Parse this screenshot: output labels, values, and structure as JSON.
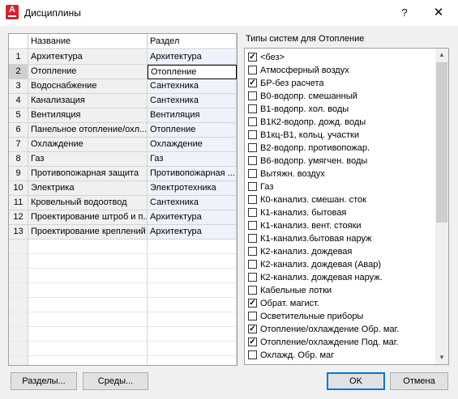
{
  "window": {
    "title": "Дисциплины",
    "help": "?",
    "close": "✕"
  },
  "grid": {
    "columns": [
      "",
      "Название",
      "Раздел"
    ],
    "rows": [
      [
        "1",
        "Архитектура",
        "Архитектура"
      ],
      [
        "2",
        "Отопление",
        "Отопление"
      ],
      [
        "3",
        "Водоснабжение",
        "Сантехника"
      ],
      [
        "4",
        "Канализация",
        "Сантехника"
      ],
      [
        "5",
        "Вентиляция",
        "Вентиляция"
      ],
      [
        "6",
        "Панельное отопление/охл...",
        "Отопление"
      ],
      [
        "7",
        "Охлаждение",
        "Охлаждение"
      ],
      [
        "8",
        "Газ",
        "Газ"
      ],
      [
        "9",
        "Противопожарная защита",
        "Противопожарная ..."
      ],
      [
        "10",
        "Электрика",
        "Электротехника"
      ],
      [
        "11",
        "Кровельный водоотвод",
        "Сантехника"
      ],
      [
        "12",
        "Проектирование штроб и п...",
        "Архитектура"
      ],
      [
        "13",
        "Проектирование креплений",
        "Архитектура"
      ]
    ],
    "selected_row": 2
  },
  "systems": {
    "label": "Типы систем для Отопление",
    "items": [
      {
        "label": "<без>",
        "checked": true
      },
      {
        "label": "Атмосферный воздух",
        "checked": false
      },
      {
        "label": "БР-без расчета",
        "checked": true
      },
      {
        "label": "В0-водопр. смешанный",
        "checked": false
      },
      {
        "label": "В1-водопр. хол. воды",
        "checked": false
      },
      {
        "label": "В1К2-водопр. дожд. воды",
        "checked": false
      },
      {
        "label": "В1кц-В1, кольц. участки",
        "checked": false
      },
      {
        "label": "В2-водопр. противопожар.",
        "checked": false
      },
      {
        "label": "В6-водопр. умягчен. воды",
        "checked": false
      },
      {
        "label": "Вытяжн. воздух",
        "checked": false
      },
      {
        "label": "Газ",
        "checked": false
      },
      {
        "label": "К0-канализ. смешан. сток",
        "checked": false
      },
      {
        "label": "К1-канализ. бытовая",
        "checked": false
      },
      {
        "label": "К1-канализ. вент. стояки",
        "checked": false
      },
      {
        "label": "К1-канализ.бытовая наруж",
        "checked": false
      },
      {
        "label": "К2-канализ. дождевая",
        "checked": false
      },
      {
        "label": "К2-канализ. дождевая (Авар)",
        "checked": false
      },
      {
        "label": "К2-канализ. дождевая наруж.",
        "checked": false
      },
      {
        "label": "Кабельные лотки",
        "checked": false
      },
      {
        "label": "Обрат. магист.",
        "checked": true
      },
      {
        "label": "Осветительные приборы",
        "checked": false
      },
      {
        "label": "Отопление/охлаждение Обр. маг.",
        "checked": true
      },
      {
        "label": "Отопление/охлаждение Под. маг.",
        "checked": true
      },
      {
        "label": "Охлажд. Обр. маг",
        "checked": false
      }
    ]
  },
  "buttons": {
    "sections": "Разделы...",
    "environments": "Среды...",
    "ok": "OK",
    "cancel": "Отмена"
  }
}
